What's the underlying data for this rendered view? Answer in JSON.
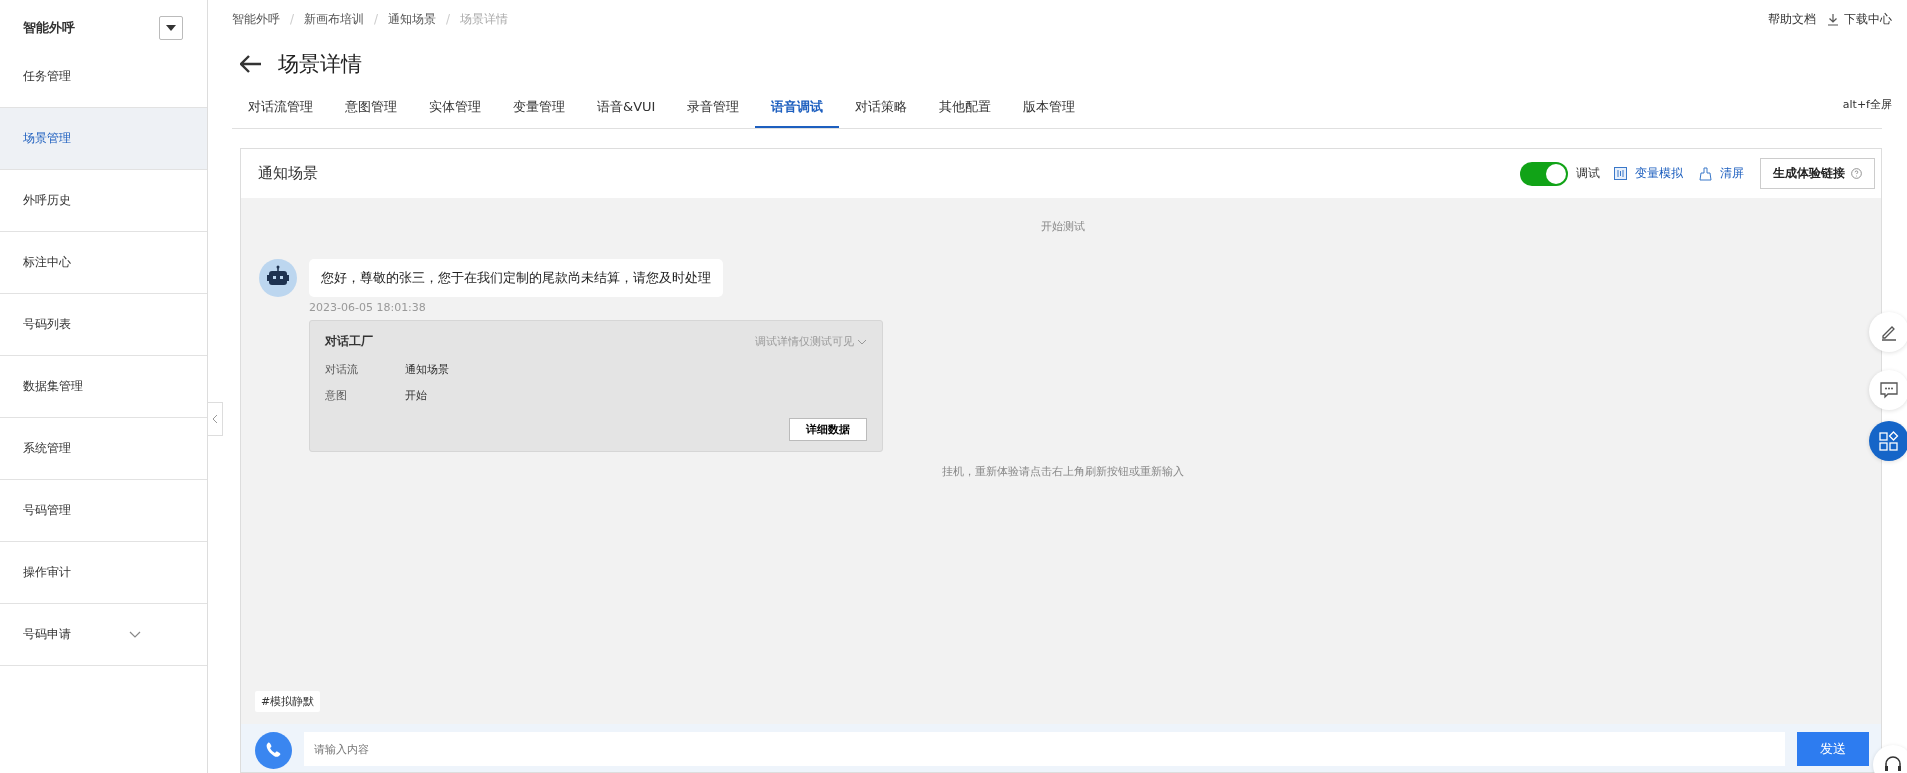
{
  "sidebar": {
    "title": "智能外呼",
    "items": [
      {
        "label": "任务管理",
        "selected": false,
        "expandable": false
      },
      {
        "label": "场景管理",
        "selected": true,
        "expandable": false
      },
      {
        "label": "外呼历史",
        "selected": false,
        "expandable": false
      },
      {
        "label": "标注中心",
        "selected": false,
        "expandable": false
      },
      {
        "label": "号码列表",
        "selected": false,
        "expandable": false
      },
      {
        "label": "数据集管理",
        "selected": false,
        "expandable": false
      },
      {
        "label": "系统管理",
        "selected": false,
        "expandable": false
      },
      {
        "label": "号码管理",
        "selected": false,
        "expandable": false
      },
      {
        "label": "操作审计",
        "selected": false,
        "expandable": false
      },
      {
        "label": "号码申请",
        "selected": false,
        "expandable": true
      }
    ]
  },
  "breadcrumb": [
    "智能外呼",
    "新画布培训",
    "通知场景",
    "场景详情"
  ],
  "breadcrumb_separator": "/",
  "top_links": [
    "帮助文档",
    "下载中心"
  ],
  "page_title": "场景详情",
  "tabs": [
    {
      "label": "对话流管理",
      "selected": false
    },
    {
      "label": "意图管理",
      "selected": false
    },
    {
      "label": "实体管理",
      "selected": false
    },
    {
      "label": "变量管理",
      "selected": false
    },
    {
      "label": "语音&VUI",
      "selected": false
    },
    {
      "label": "录音管理",
      "selected": false
    },
    {
      "label": "语音调试",
      "selected": true
    },
    {
      "label": "对话策略",
      "selected": false
    },
    {
      "label": "其他配置",
      "selected": false
    },
    {
      "label": "版本管理",
      "selected": false
    }
  ],
  "fullscreen_hint": "alt+f全屏",
  "panel": {
    "title": "通知场景",
    "debug_toggle": {
      "label": "调试",
      "on": true
    },
    "variable_sim": "变量模拟",
    "clear": "清屏",
    "link_button": "生成体验链接"
  },
  "chat": {
    "start_note": "开始测试",
    "message": {
      "text": "您好，尊敬的张三，您于在我们定制的尾款尚未结算，请您及时处理",
      "time": "2023-06-05 18:01:38"
    },
    "debug_card": {
      "title": "对话工厂",
      "visibility": "调试详情仅测试可见",
      "rows": [
        {
          "label": "对话流",
          "value": "通知场景"
        },
        {
          "label": "意图",
          "value": "开始"
        }
      ],
      "button": "详细数据"
    },
    "end_note": "挂机，重新体验请点击右上角刷新按钮或重新输入",
    "tag": "#模拟静默"
  },
  "input": {
    "placeholder": "请输入内容",
    "send": "发送"
  }
}
